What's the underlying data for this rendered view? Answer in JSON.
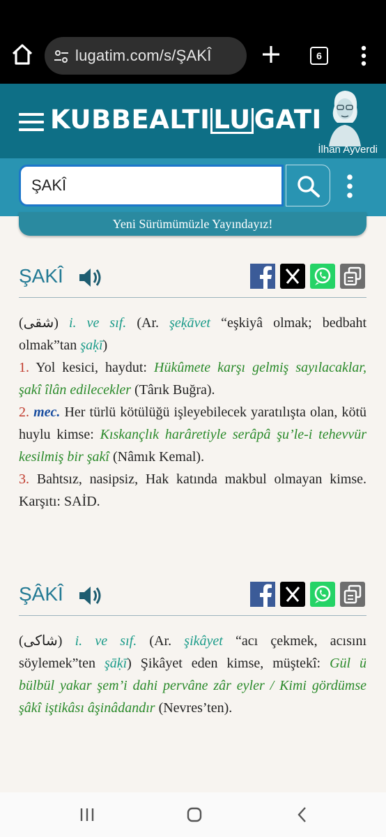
{
  "browser": {
    "url": "lugatim.com/s/ŞAKÎ",
    "tab_count": "6",
    "icons": [
      "home-icon",
      "tune-icon",
      "plus-icon",
      "tabs-icon",
      "more-vert-icon"
    ]
  },
  "site": {
    "logo": {
      "part1": "KUBBEALTI",
      "part2": "LU",
      "part3": "GATI"
    },
    "person_name": "İlhan Ayverdi",
    "search_value": "ŞAKÎ",
    "banner": "Yeni Sürümümüzle Yayındayız!"
  },
  "entries": [
    {
      "word": "ŞAKÎ",
      "arabic": "(شقى)",
      "pos": "i. ve sıf.",
      "ar_open": "(Ar.",
      "etym_root": "şeḳāvet",
      "etym_meaning": "“eşkiyâ olmak; bedbaht olmak”tan",
      "etym_word": "şaḳī",
      "close": ")",
      "senses": [
        {
          "num": "1.",
          "text": "Yol kesici, haydut:",
          "example": "Hükûmete karşı gelmiş sayılacaklar, şakî îlân edilecekler",
          "source": "(Târık Buğra)."
        },
        {
          "num": "2.",
          "label": "mec.",
          "text": "Her türlü kötülüğü işleyebilecek yaratılışta olan, kötü huylu kimse:",
          "example": "Kıskançlık harâretiyle serâpâ şu’le-i tehevvür kesilmiş bir şakî",
          "source": "(Nâmık Kemal)."
        },
        {
          "num": "3.",
          "text": "Bahtsız, nasipsiz, Hak katında makbul olmayan kimse. Karşıtı: SAİD."
        }
      ]
    },
    {
      "word": "ŞÂKÎ",
      "arabic": "(شاكى)",
      "pos": "i. ve sıf.",
      "ar_open": "(Ar.",
      "etym_root": "şikâyet",
      "etym_meaning": "“acı çekmek, acısını söylemek”ten",
      "etym_word": "şāḳī",
      "close": ")",
      "text": "Şikâyet eden kimse, müştekî:",
      "example": "Gül ü bülbül yakar şem’i dahi pervâne zâr eyler / Kimi gördümse şâkî iştikâsı âşinâdandır",
      "source": "(Nevres’ten)."
    }
  ],
  "share_icons": [
    "facebook-icon",
    "x-icon",
    "whatsapp-icon",
    "copy-icon"
  ],
  "colors": {
    "header": "#0e6f86",
    "search_band": "#2994b2",
    "headword": "#237a94",
    "example": "#2a8a2a",
    "pos": "#1a9b89",
    "sense_number": "#c0392b"
  }
}
